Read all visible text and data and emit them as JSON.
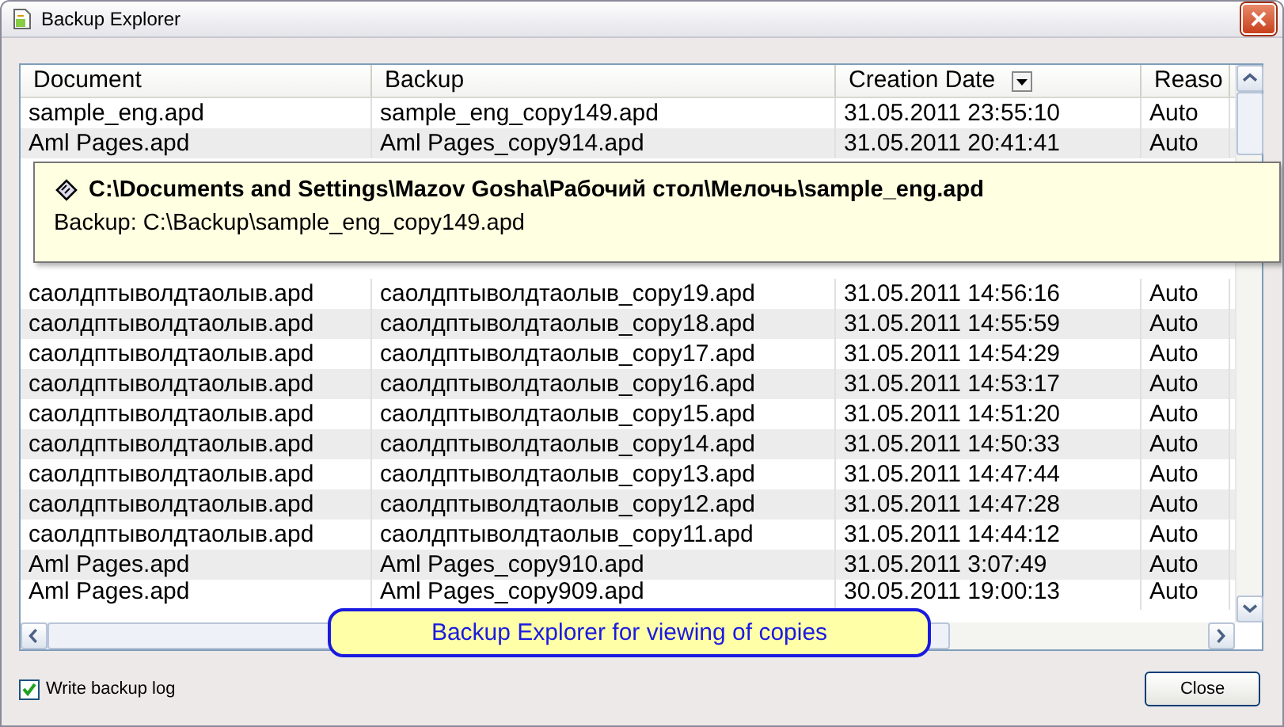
{
  "window": {
    "title": "Backup Explorer"
  },
  "table": {
    "columns": [
      {
        "label": "Document",
        "sorted": false
      },
      {
        "label": "Backup",
        "sorted": false
      },
      {
        "label": "Creation Date",
        "sorted": true
      },
      {
        "label": "Reaso",
        "sorted": false
      }
    ],
    "rows": [
      {
        "document": "sample_eng.apd",
        "backup": "sample_eng_copy149.apd",
        "date": "31.05.2011 23:55:10",
        "reason": "Auto"
      },
      {
        "document": "Aml Pages.apd",
        "backup": "Aml Pages_copy914.apd",
        "date": "31.05.2011 20:41:41",
        "reason": "Auto"
      },
      {
        "document": "саолдптыволдтаолыв.apd",
        "backup": "саолдптыволдтаолыв_copy19.apd",
        "date": "31.05.2011 14:56:16",
        "reason": "Auto"
      },
      {
        "document": "саолдптыволдтаолыв.apd",
        "backup": "саолдптыволдтаолыв_copy18.apd",
        "date": "31.05.2011 14:55:59",
        "reason": "Auto"
      },
      {
        "document": "саолдптыволдтаолыв.apd",
        "backup": "саолдптыволдтаолыв_copy17.apd",
        "date": "31.05.2011 14:54:29",
        "reason": "Auto"
      },
      {
        "document": "саолдптыволдтаолыв.apd",
        "backup": "саолдптыволдтаолыв_copy16.apd",
        "date": "31.05.2011 14:53:17",
        "reason": "Auto"
      },
      {
        "document": "саолдптыволдтаолыв.apd",
        "backup": "саолдптыволдтаолыв_copy15.apd",
        "date": "31.05.2011 14:51:20",
        "reason": "Auto"
      },
      {
        "document": "саолдптыволдтаолыв.apd",
        "backup": "саолдптыволдтаолыв_copy14.apd",
        "date": "31.05.2011 14:50:33",
        "reason": "Auto"
      },
      {
        "document": "саолдптыволдтаолыв.apd",
        "backup": "саолдптыволдтаолыв_copy13.apd",
        "date": "31.05.2011 14:47:44",
        "reason": "Auto"
      },
      {
        "document": "саолдптыволдтаолыв.apd",
        "backup": "саолдптыволдтаолыв_copy12.apd",
        "date": "31.05.2011 14:47:28",
        "reason": "Auto"
      },
      {
        "document": "саолдптыволдтаолыв.apd",
        "backup": "саолдптыволдтаолыв_copy11.apd",
        "date": "31.05.2011 14:44:12",
        "reason": "Auto"
      },
      {
        "document": "Aml Pages.apd",
        "backup": "Aml Pages_copy910.apd",
        "date": "31.05.2011 3:07:49",
        "reason": "Auto"
      },
      {
        "document": "Aml Pages.apd",
        "backup": "Aml Pages_copy909.apd",
        "date": "30.05.2011 19:00:13",
        "reason": "Auto"
      }
    ]
  },
  "tooltip": {
    "path": "C:\\Documents and Settings\\Mazov Gosha\\Рабочий стол\\Мелочь\\sample_eng.apd",
    "backup": "Backup: C:\\Backup\\sample_eng_copy149.apd"
  },
  "callout": {
    "text": "Backup Explorer for viewing of copies"
  },
  "write_log": {
    "label": "Write backup log",
    "checked": true
  },
  "buttons": [
    "Close"
  ]
}
